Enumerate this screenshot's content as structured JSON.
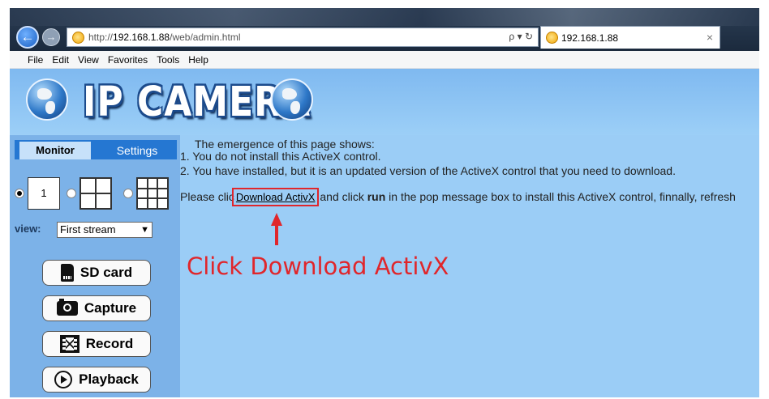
{
  "browser": {
    "url_prefix": "http://",
    "url_host": "192.168.1.88",
    "url_path": "/web/admin.html",
    "address_tools": "ρ ▾ ↻",
    "back_glyph": "←",
    "forward_glyph": "→",
    "tab_title": "192.168.1.88",
    "tab_close": "×"
  },
  "menu": [
    "File",
    "Edit",
    "View",
    "Favorites",
    "Tools",
    "Help"
  ],
  "header": {
    "title": "IP CAMERA"
  },
  "left_panel": {
    "tabs": {
      "monitor": "Monitor",
      "settings": "Settings"
    },
    "layout_single_label": "1",
    "view_label": "view:",
    "view_selected": "First stream",
    "select_arrow": "▼",
    "buttons": {
      "sd_card": "SD card",
      "capture": "Capture",
      "record": "Record",
      "playback": "Playback"
    }
  },
  "main": {
    "line1": "The emergence of this page shows:",
    "line2": "1. You do not install this ActiveX control.",
    "line3": "2. You have installed, but it is an updated version of the ActiveX control that you need to download.",
    "line4_prefix": "Please clic",
    "download_link": "Download ActivX",
    "line4_mid": " and click ",
    "line4_bold": "run",
    "line4_suffix": " in the pop message box to install this ActiveX control, finnally, refresh"
  },
  "annotation": {
    "text": "Click Download ActivX",
    "color": "#e0262b"
  },
  "colors": {
    "page_bg": "#9bcdf6",
    "left_panel_bg": "#7cb2e8",
    "tab_bar_bg": "#2577d2",
    "accent_red": "#e0262b"
  }
}
